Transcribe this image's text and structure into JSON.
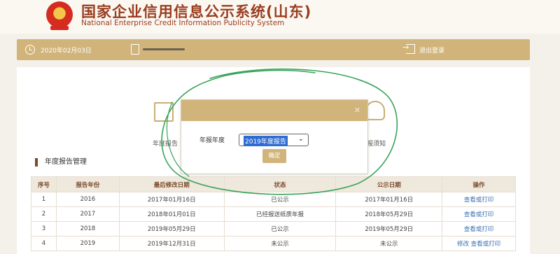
{
  "header": {
    "title": "国家企业信用信息公示系统(山东)",
    "subtitle": "National Enterprise Credit Information Publicity System"
  },
  "topbar": {
    "date": "2020年02月03日",
    "logout_label": "退出登录"
  },
  "tools": [
    {
      "label": "年度报告",
      "icon": "edit-icon"
    },
    {
      "label": "报须知",
      "icon": "lightbulb-icon"
    }
  ],
  "section": {
    "title": "年度报告管理"
  },
  "table": {
    "headers": [
      "序号",
      "报告年份",
      "最后修改日期",
      "状态",
      "公示日期",
      "操作"
    ],
    "rows": [
      [
        "1",
        "2016",
        "2017年01月16日",
        "已公示",
        "2017年01月16日",
        "查看或打印"
      ],
      [
        "2",
        "2017",
        "2018年01月01日",
        "已经报送纸质年报",
        "2018年05月29日",
        "查看或打印"
      ],
      [
        "3",
        "2018",
        "2019年05月29日",
        "已公示",
        "2019年05月29日",
        "查看或打印"
      ],
      [
        "4",
        "2019",
        "2019年12月31日",
        "未公示",
        "未公示",
        "修改 查看或打印"
      ]
    ]
  },
  "dialog": {
    "field_label": "年报年度",
    "selected_option": "2019年度报告",
    "confirm_label": "确定"
  },
  "colors": {
    "gold": "#d1b47a",
    "title_red": "#9a3c1f",
    "link_blue": "#3a6fb0",
    "annotation_green": "#3aa35a"
  }
}
